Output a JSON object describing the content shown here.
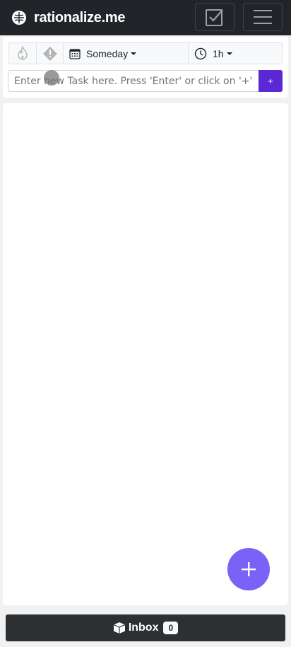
{
  "app": {
    "brand": "rationalize.me"
  },
  "navbar": {
    "tasks_icon": "checkbox-check-icon",
    "menu_icon": "hamburger-icon"
  },
  "task_options": {
    "priority_icon": "flame-icon",
    "important_icon": "alert-diamond-icon",
    "due": {
      "icon": "calendar-icon",
      "label": "Someday"
    },
    "duration": {
      "icon": "clock-icon",
      "label": "1h"
    }
  },
  "new_task": {
    "placeholder": "Enter new Task here. Press 'Enter' or click on '+' button",
    "value": "",
    "add_label": "+"
  },
  "fab": {
    "icon": "plus-icon"
  },
  "bottom_bar": {
    "icon": "box-icon",
    "label": "Inbox",
    "count": "0"
  },
  "colors": {
    "accent": "#5b28d6",
    "fab": "#7b61f5",
    "navbar": "#212529",
    "bottom_bar": "#2d3033"
  }
}
